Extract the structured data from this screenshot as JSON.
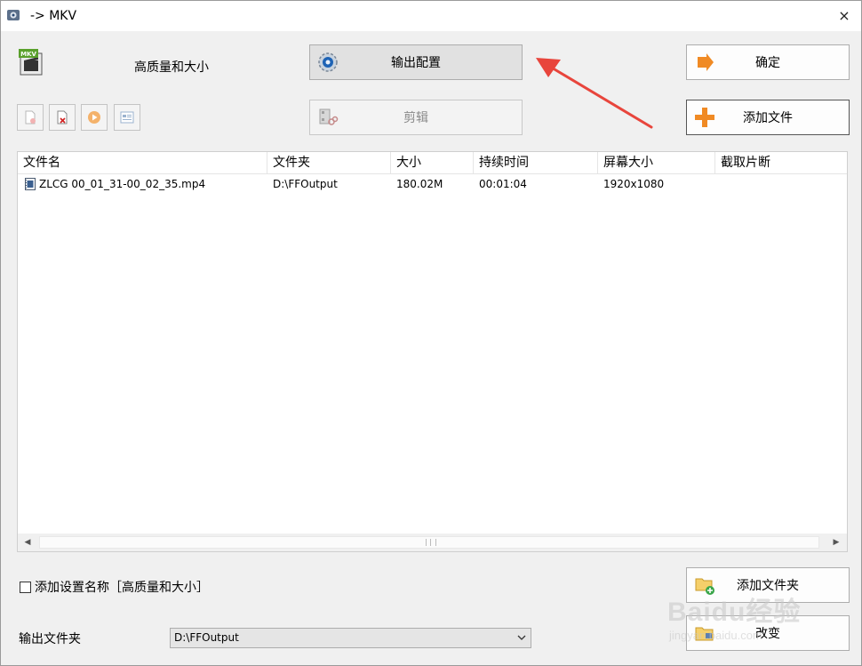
{
  "window": {
    "title": "-> MKV",
    "close_glyph": "×"
  },
  "preset": {
    "label": "高质量和大小",
    "format_badge": "MKV"
  },
  "buttons": {
    "output_config": "输出配置",
    "clip": "剪辑",
    "ok": "确定",
    "add_file": "添加文件",
    "add_folder": "添加文件夹",
    "change": "改变"
  },
  "toolbar": {
    "icons": [
      "remove-file-icon",
      "delete-file-icon",
      "play-icon",
      "info-icon"
    ]
  },
  "file_list": {
    "columns": [
      "文件名",
      "文件夹",
      "大小",
      "持续时间",
      "屏幕大小",
      "截取片断"
    ],
    "rows": [
      {
        "name": "ZLCG 00_01_31-00_02_35.mp4",
        "folder": "D:\\FFOutput",
        "size": "180.02M",
        "duration": "00:01:04",
        "screen": "1920x1080",
        "clip": ""
      }
    ]
  },
  "footer": {
    "checkbox_label": "添加设置名称［高质量和大小］",
    "checkbox_checked": false,
    "output_folder_label": "输出文件夹",
    "output_folder_value": "D:\\FFOutput"
  },
  "watermark": {
    "text": "Baidu经验",
    "sub": "jingyan.baidu.com"
  },
  "colors": {
    "accent_arrow": "#e8453c",
    "add_icon": "#f08a24"
  }
}
